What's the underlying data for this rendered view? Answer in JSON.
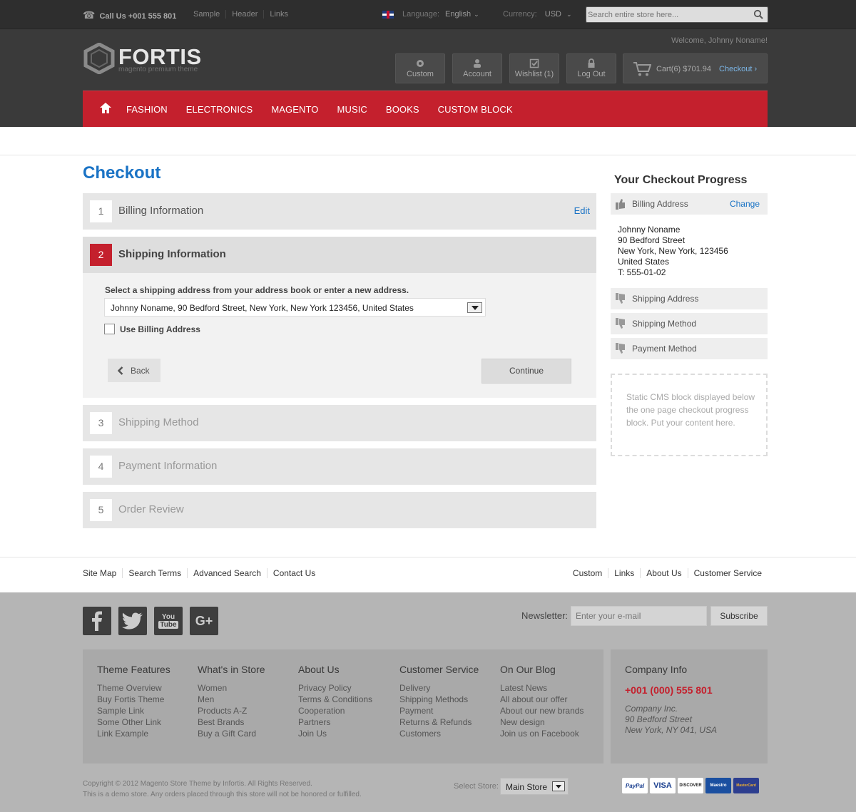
{
  "topbar": {
    "call": "Call Us +001 555 801",
    "links": [
      "Sample",
      "Header",
      "Links"
    ],
    "language_label": "Language:",
    "language_value": "English",
    "currency_label": "Currency:",
    "currency_value": "USD",
    "search_placeholder": "Search entire store here..."
  },
  "header": {
    "welcome": "Welcome, Johnny Noname!",
    "logo_name": "FORTIS",
    "logo_tagline": "magento premium theme",
    "buttons": {
      "custom": "Custom",
      "account": "Account",
      "wishlist": "Wishlist (1)",
      "logout": "Log Out"
    },
    "cart_text": "Cart(6)  $701.94",
    "checkout_label": "Checkout"
  },
  "nav": {
    "items": [
      "FASHION",
      "ELECTRONICS",
      "MAGENTO",
      "MUSIC",
      "BOOKS",
      "CUSTOM BLOCK"
    ]
  },
  "checkout": {
    "title": "Checkout",
    "steps": [
      {
        "num": "1",
        "title": "Billing Information",
        "action": "Edit"
      },
      {
        "num": "2",
        "title": "Shipping Information"
      },
      {
        "num": "3",
        "title": "Shipping Method"
      },
      {
        "num": "4",
        "title": "Payment Information"
      },
      {
        "num": "5",
        "title": "Order Review"
      }
    ],
    "shipping": {
      "instruction": "Select a shipping address from your address book or enter a new address.",
      "selected_address": "Johnny Noname, 90 Bedford Street, New York, New York 123456, United States",
      "use_billing_label": "Use Billing Address",
      "use_billing_checked": false,
      "back_label": "Back",
      "continue_label": "Continue"
    }
  },
  "progress": {
    "title": "Your Checkout Progress",
    "billing_label": "Billing Address",
    "change_label": "Change",
    "billing_lines": [
      "Johnny Noname",
      "90 Bedford Street",
      "New York, New York, 123456",
      "United States",
      "T: 555-01-02"
    ],
    "items": [
      "Shipping Address",
      "Shipping Method",
      "Payment Method"
    ],
    "cms_text": "Static CMS block displayed below the one page checkout progress block. Put your content here."
  },
  "footer_links": {
    "left": [
      "Site Map",
      "Search Terms",
      "Advanced Search",
      "Contact Us"
    ],
    "right": [
      "Custom",
      "Links",
      "About Us",
      "Customer Service"
    ]
  },
  "footer": {
    "social": [
      "facebook",
      "twitter",
      "youtube",
      "google-plus"
    ],
    "newsletter_label": "Newsletter:",
    "newsletter_placeholder": "Enter your e-mail",
    "subscribe_label": "Subscribe",
    "columns": [
      {
        "title": "Theme Features",
        "links": [
          "Theme Overview",
          "Buy Fortis Theme",
          "Sample Link",
          "Some Other Link",
          "Link Example"
        ]
      },
      {
        "title": "What's in Store",
        "links": [
          "Women",
          "Men",
          "Products A-Z",
          "Best Brands",
          "Buy a Gift Card"
        ]
      },
      {
        "title": "About Us",
        "links": [
          "Privacy Policy",
          "Terms & Conditions",
          "Cooperation",
          "Partners",
          "Join Us"
        ]
      },
      {
        "title": "Customer Service",
        "links": [
          "Delivery",
          "Shipping Methods",
          "Payment",
          "Returns & Refunds",
          "Customers"
        ]
      },
      {
        "title": "On Our Blog",
        "links": [
          "Latest News",
          "All about our offer",
          "About our new brands",
          "New design",
          "Join us on Facebook"
        ]
      }
    ],
    "company": {
      "title": "Company Info",
      "phone": "+001 (000) 555 801",
      "lines": [
        "Company Inc.",
        "90 Bedford Street",
        "New York, NY 041, USA"
      ]
    },
    "copyright": [
      "Copyright © 2012 Magento Store Theme by Infortis. All Rights Reserved.",
      "This is a demo store. Any orders placed through this store will not be honored or fulfilled."
    ],
    "store_label": "Select Store:",
    "store_value": "Main Store",
    "payments": [
      "PayPal",
      "VISA",
      "DISCOVER",
      "Maestro",
      "MasterCard"
    ]
  },
  "colors": {
    "accent_red": "#c4202d",
    "link_blue": "#1a73c5",
    "header_dark": "#3a3a3a"
  }
}
